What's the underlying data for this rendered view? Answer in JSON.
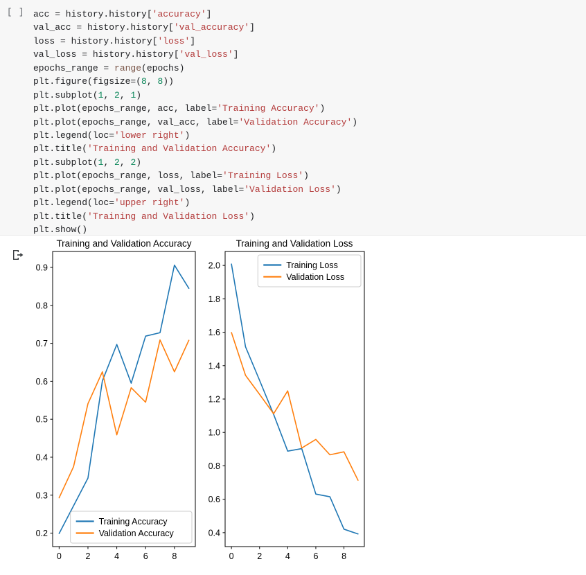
{
  "notebook": {
    "cell_prompt": "[ ]",
    "output_icon": "output-arrow-icon",
    "code_lines": [
      [
        [
          "acc = history.history[",
          "plain"
        ],
        [
          "'accuracy'",
          "str"
        ],
        [
          "]",
          "plain"
        ]
      ],
      [
        [
          "val_acc = history.history[",
          "plain"
        ],
        [
          "'val_accuracy'",
          "str"
        ],
        [
          "]",
          "plain"
        ]
      ],
      [
        [
          "loss = history.history[",
          "plain"
        ],
        [
          "'loss'",
          "str"
        ],
        [
          "]",
          "plain"
        ]
      ],
      [
        [
          "val_loss = history.history[",
          "plain"
        ],
        [
          "'val_loss'",
          "str"
        ],
        [
          "]",
          "plain"
        ]
      ],
      [
        [
          "epochs_range = ",
          "plain"
        ],
        [
          "range",
          "fn"
        ],
        [
          "(epochs)",
          "plain"
        ]
      ],
      [
        [
          "plt.figure(figsize=(",
          "plain"
        ],
        [
          "8",
          "num"
        ],
        [
          ", ",
          "plain"
        ],
        [
          "8",
          "num"
        ],
        [
          "))",
          "plain"
        ]
      ],
      [
        [
          "plt.subplot(",
          "plain"
        ],
        [
          "1",
          "num"
        ],
        [
          ", ",
          "plain"
        ],
        [
          "2",
          "num"
        ],
        [
          ", ",
          "plain"
        ],
        [
          "1",
          "num"
        ],
        [
          ")",
          "plain"
        ]
      ],
      [
        [
          "plt.plot(epochs_range, acc, label=",
          "plain"
        ],
        [
          "'Training Accuracy'",
          "str"
        ],
        [
          ")",
          "plain"
        ]
      ],
      [
        [
          "plt.plot(epochs_range, val_acc, label=",
          "plain"
        ],
        [
          "'Validation Accuracy'",
          "str"
        ],
        [
          ")",
          "plain"
        ]
      ],
      [
        [
          "plt.legend(loc=",
          "plain"
        ],
        [
          "'lower right'",
          "str"
        ],
        [
          ")",
          "plain"
        ]
      ],
      [
        [
          "plt.title(",
          "plain"
        ],
        [
          "'Training and Validation Accuracy'",
          "str"
        ],
        [
          ")",
          "plain"
        ]
      ],
      [
        [
          "plt.subplot(",
          "plain"
        ],
        [
          "1",
          "num"
        ],
        [
          ", ",
          "plain"
        ],
        [
          "2",
          "num"
        ],
        [
          ", ",
          "plain"
        ],
        [
          "2",
          "num"
        ],
        [
          ")",
          "plain"
        ]
      ],
      [
        [
          "plt.plot(epochs_range, loss, label=",
          "plain"
        ],
        [
          "'Training Loss'",
          "str"
        ],
        [
          ")",
          "plain"
        ]
      ],
      [
        [
          "plt.plot(epochs_range, val_loss, label=",
          "plain"
        ],
        [
          "'Validation Loss'",
          "str"
        ],
        [
          ")",
          "plain"
        ]
      ],
      [
        [
          "plt.legend(loc=",
          "plain"
        ],
        [
          "'upper right'",
          "str"
        ],
        [
          ")",
          "plain"
        ]
      ],
      [
        [
          "plt.title(",
          "plain"
        ],
        [
          "'Training and Validation Loss'",
          "str"
        ],
        [
          ")",
          "plain"
        ]
      ],
      [
        [
          "plt.show()",
          "plain"
        ]
      ]
    ]
  },
  "colors": {
    "train_line": "#1f77b4",
    "val_line": "#ff7f0e",
    "axis": "#000000",
    "code_bg": "#f7f7f7",
    "string": "#b33b3b",
    "number": "#098658",
    "builtin": "#795548"
  },
  "chart_data": [
    {
      "type": "line",
      "title": "Training and Validation Accuracy",
      "xlabel": "",
      "ylabel": "",
      "x": [
        0,
        1,
        2,
        3,
        4,
        5,
        6,
        7,
        8,
        9
      ],
      "xlim": [
        -0.45,
        9.45
      ],
      "ylim": [
        0.1645,
        0.942
      ],
      "xticks": [
        0,
        2,
        4,
        6,
        8
      ],
      "xticklabels": [
        "0",
        "2",
        "4",
        "6",
        "8"
      ],
      "yticks": [
        0.2,
        0.3,
        0.4,
        0.5,
        0.6,
        0.7,
        0.8,
        0.9
      ],
      "yticklabels": [
        "0.2",
        "0.3",
        "0.4",
        "0.5",
        "0.6",
        "0.7",
        "0.8",
        "0.9"
      ],
      "grid": false,
      "legend_position": "lower right",
      "series": [
        {
          "name": "Training Accuracy",
          "color": "#1f77b4",
          "values": [
            0.199,
            0.272,
            0.345,
            0.601,
            0.697,
            0.595,
            0.719,
            0.728,
            0.906,
            0.845
          ]
        },
        {
          "name": "Validation Accuracy",
          "color": "#ff7f0e",
          "values": [
            0.293,
            0.375,
            0.541,
            0.625,
            0.459,
            0.583,
            0.545,
            0.709,
            0.625,
            0.708
          ]
        }
      ]
    },
    {
      "type": "line",
      "title": "Training and Validation Loss",
      "xlabel": "",
      "ylabel": "",
      "x": [
        0,
        1,
        2,
        3,
        4,
        5,
        6,
        7,
        8,
        9
      ],
      "xlim": [
        -0.45,
        9.45
      ],
      "ylim": [
        0.3165,
        2.0835
      ],
      "xticks": [
        0,
        2,
        4,
        6,
        8
      ],
      "xticklabels": [
        "0",
        "2",
        "4",
        "6",
        "8"
      ],
      "yticks": [
        0.4,
        0.6,
        0.8,
        1.0,
        1.2,
        1.4,
        1.6,
        1.8,
        2.0
      ],
      "yticklabels": [
        "0.4",
        "0.6",
        "0.8",
        "1.0",
        "1.2",
        "1.4",
        "1.6",
        "1.8",
        "2.0"
      ],
      "grid": false,
      "legend_position": "upper right",
      "series": [
        {
          "name": "Training Loss",
          "color": "#1f77b4",
          "values": [
            2.008,
            1.513,
            1.312,
            1.108,
            0.888,
            0.903,
            0.631,
            0.615,
            0.421,
            0.392
          ]
        },
        {
          "name": "Validation Loss",
          "color": "#ff7f0e",
          "values": [
            1.598,
            1.342,
            1.228,
            1.112,
            1.249,
            0.907,
            0.958,
            0.866,
            0.884,
            0.714
          ]
        }
      ]
    }
  ]
}
